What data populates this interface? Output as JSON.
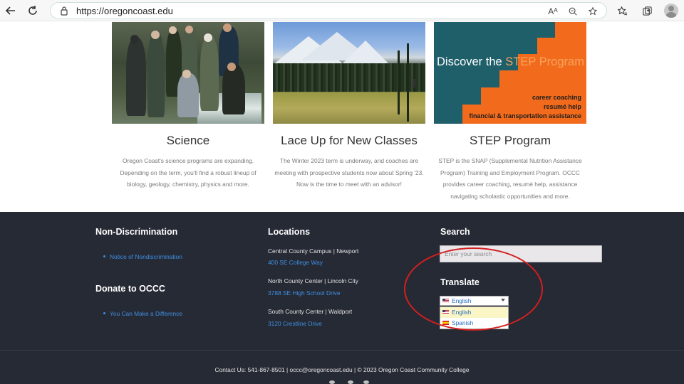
{
  "browser": {
    "url": "https://oregoncoast.edu",
    "icons": [
      "back-arrow-icon",
      "refresh-icon",
      "lock-icon",
      "read-aloud-icon",
      "zoom-icon",
      "favorite-add-icon",
      "favorites-icon",
      "collections-icon",
      "profile-icon"
    ],
    "read_aloud_glyph": "Aᴬ"
  },
  "cards": [
    {
      "title": "Science",
      "text": "Oregon Coast's science programs are expanding. Depending on the term, you'll find a robust lineup of biology, geology, chemistry, physics and more."
    },
    {
      "title": "Lace Up for New Classes",
      "text": "The Winter 2023 term is underway, and coaches are meeting with prospective students now about Spring '23. Now is the time to meet with an advisor!"
    },
    {
      "title": "STEP Program",
      "text": "STEP is the SNAP (Supplemental Nutrition Assistance Program) Training and Employment Program. OCCC provides career coaching, resumé help, assistance navigating scholastic opportunities and more.",
      "image_title_plain": "Discover the ",
      "image_title_highlight": "STEP Program",
      "image_lines": [
        "career coaching",
        "resumé help",
        "financial & transportation assistance"
      ]
    }
  ],
  "footer": {
    "non_discrimination": {
      "heading": "Non-Discrimination",
      "link": "Notice of Nondiscrimination"
    },
    "donate": {
      "heading": "Donate to OCCC",
      "link": "You Can Make a Difference"
    },
    "locations": {
      "heading": "Locations",
      "items": [
        {
          "name": "Central County Campus | Newport",
          "address": "400 SE College Way"
        },
        {
          "name": "North County Center | Lincoln City",
          "address": "3788 SE High School Drive"
        },
        {
          "name": "South County Center | Waldport",
          "address": "3120 Crestline Drive"
        }
      ]
    },
    "search": {
      "heading": "Search",
      "placeholder": "Enter your search"
    },
    "translate": {
      "heading": "Translate",
      "selected": "English",
      "options": [
        "English",
        "Spanish"
      ]
    },
    "copyright": "Contact Us: 541-867-8501 | occc@oregoncoast.edu | © 2023 Oregon Coast Community College"
  },
  "colors": {
    "footer_bg": "#262a35",
    "link": "#3e8fe0",
    "highlight_circle": "#d41f1f",
    "step_orange": "#f26b1d",
    "step_teal": "#1f5f6a"
  }
}
